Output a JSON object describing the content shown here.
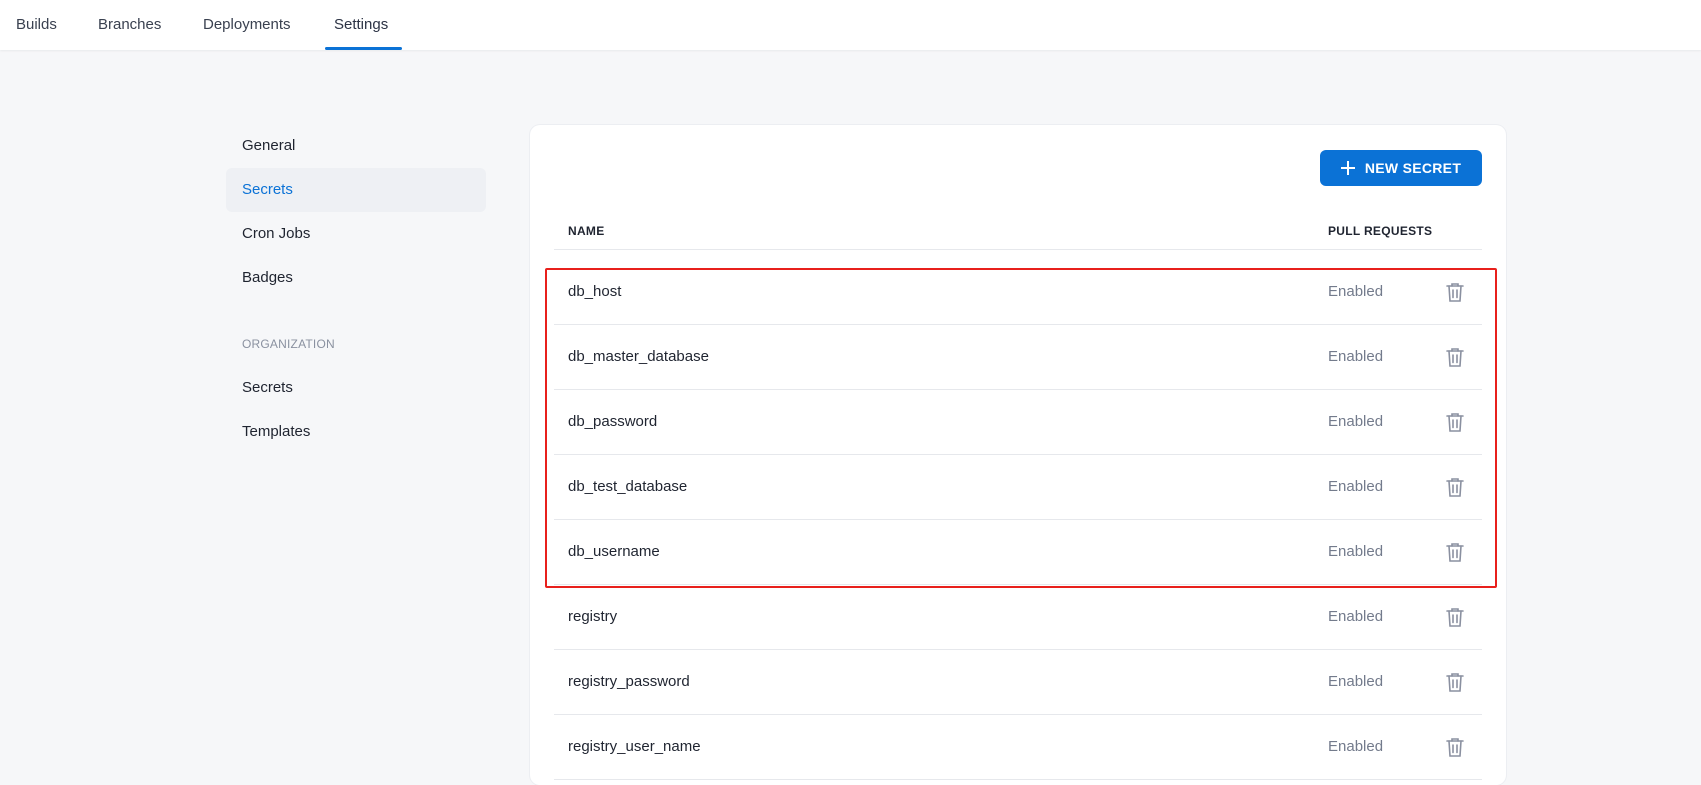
{
  "tabs": [
    {
      "label": "Builds",
      "active": false
    },
    {
      "label": "Branches",
      "active": false
    },
    {
      "label": "Deployments",
      "active": false
    },
    {
      "label": "Settings",
      "active": true
    }
  ],
  "sidebar": {
    "items": [
      {
        "label": "General",
        "active": false
      },
      {
        "label": "Secrets",
        "active": true
      },
      {
        "label": "Cron Jobs",
        "active": false
      },
      {
        "label": "Badges",
        "active": false
      }
    ],
    "org_heading": "ORGANIZATION",
    "org_items": [
      {
        "label": "Secrets"
      },
      {
        "label": "Templates"
      }
    ]
  },
  "toolbar": {
    "new_secret_label": "NEW SECRET",
    "new_secret_icon": "plus-icon"
  },
  "table": {
    "headers": {
      "name": "NAME",
      "pull_requests": "PULL REQUESTS"
    },
    "rows": [
      {
        "name": "db_host",
        "pull_requests": "Enabled"
      },
      {
        "name": "db_master_database",
        "pull_requests": "Enabled"
      },
      {
        "name": "db_password",
        "pull_requests": "Enabled"
      },
      {
        "name": "db_test_database",
        "pull_requests": "Enabled"
      },
      {
        "name": "db_username",
        "pull_requests": "Enabled"
      },
      {
        "name": "registry",
        "pull_requests": "Enabled"
      },
      {
        "name": "registry_password",
        "pull_requests": "Enabled"
      },
      {
        "name": "registry_user_name",
        "pull_requests": "Enabled"
      }
    ],
    "row_action_icon": "trash-icon"
  },
  "colors": {
    "accent": "#0b72d6",
    "highlight": "#e8201c",
    "background": "#f6f7f9",
    "muted_text": "#737b8c"
  }
}
